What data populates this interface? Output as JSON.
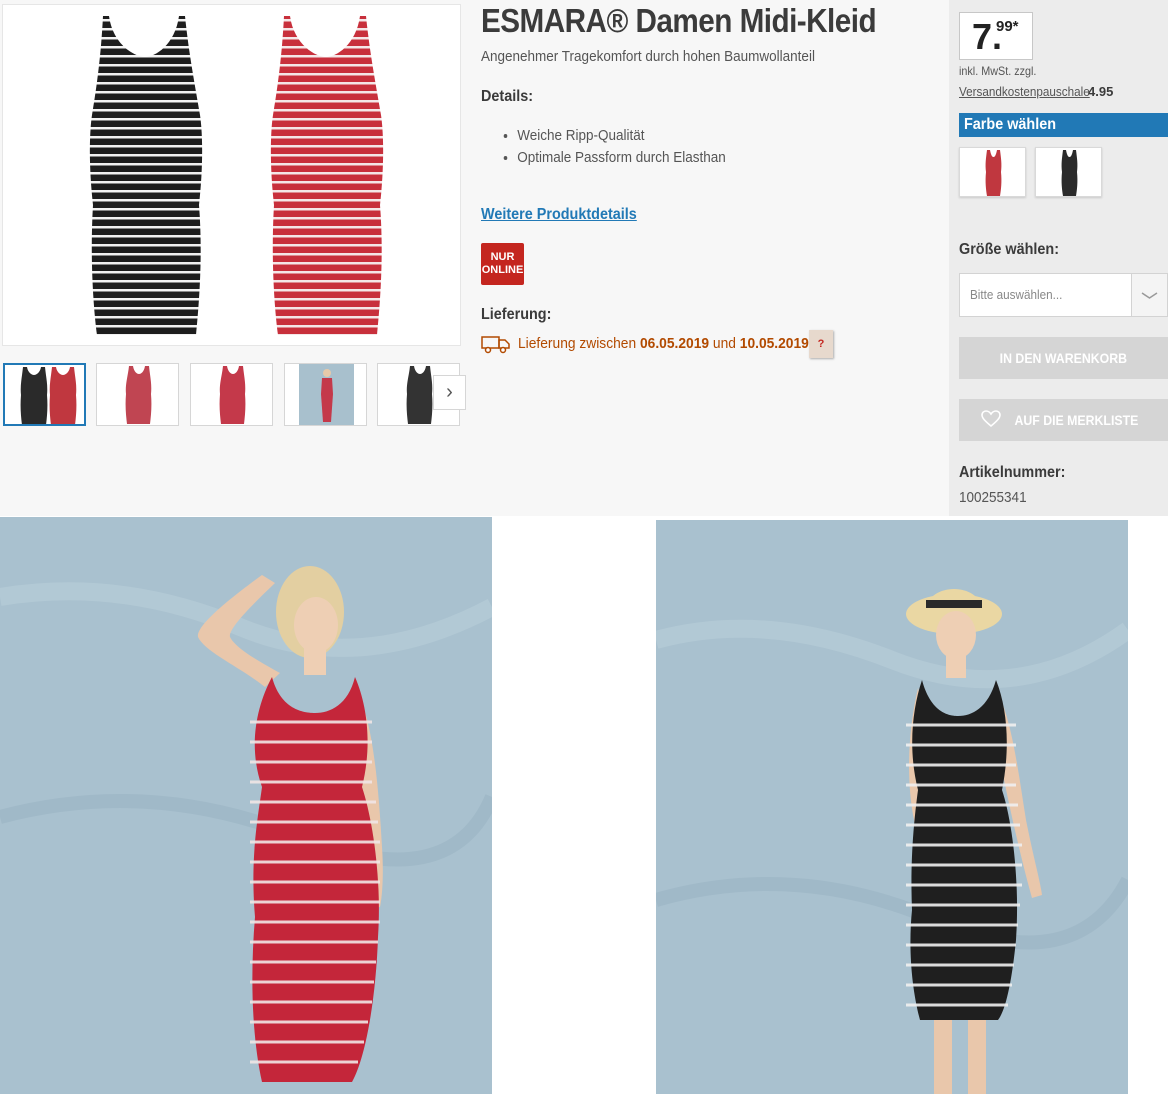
{
  "product": {
    "title": "ESMARA® Damen Midi-Kleid",
    "subtitle": "Angenehmer Tragekomfort durch hohen Baumwollanteil",
    "details_heading": "Details:",
    "details": [
      "Weiche Ripp-Qualität",
      "Optimale Passform durch Elasthan"
    ],
    "more_details_link": "Weitere Produktdetails",
    "badge_line1": "NUR",
    "badge_line2": "ONLINE",
    "delivery_heading": "Lieferung:",
    "delivery_prefix": "Lieferung zwischen",
    "delivery_from": "06.05.2019",
    "delivery_and": "und",
    "delivery_to": "10.05.2019",
    "delivery_suffix": ".",
    "help_label": "?"
  },
  "purchase": {
    "price_main": "7.",
    "price_cents": "99*",
    "price_note": "inkl. MwSt. zzgl.",
    "shipping_label": "Versandkostenpauschale",
    "shipping_value": "4.95",
    "color_heading": "Farbe wählen",
    "colors": [
      {
        "name": "rot-weiß gestreift",
        "hex": "#c0373f"
      },
      {
        "name": "schwarz-weiß gestreift",
        "hex": "#2b2b2b"
      }
    ],
    "size_heading": "Größe wählen:",
    "size_placeholder": "Bitte auswählen...",
    "add_to_cart": "IN DEN WARENKORB",
    "wishlist": "AUF DIE MERKLISTE",
    "article_label": "Artikelnummer:",
    "article_number": "100255341"
  },
  "gallery": {
    "next_icon": "chevron-right-icon",
    "thumbnails": [
      {
        "kind": "both-dresses",
        "active": true
      },
      {
        "kind": "red-dress",
        "active": false
      },
      {
        "kind": "red-dress",
        "active": false
      },
      {
        "kind": "model-photo",
        "active": false
      },
      {
        "kind": "black-dress",
        "active": false
      }
    ]
  },
  "theme": {
    "accent": "#2179b6",
    "badge": "#c4261f",
    "delivery": "#b24a00",
    "disabled_button": "#d5d5d5",
    "dress_red": "#c0373f",
    "dress_black": "#1f1f1f",
    "backdrop": "#a9c1cf"
  }
}
